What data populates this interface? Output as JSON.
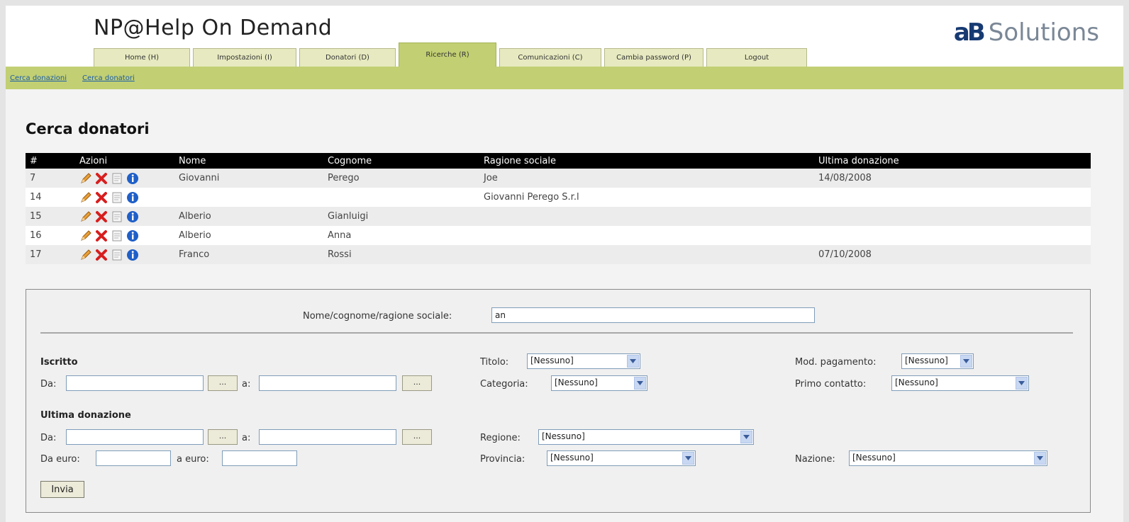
{
  "app": {
    "title": "NP@Help On Demand",
    "brand_mark": "aB",
    "brand_text": "Solutions"
  },
  "tabs": [
    {
      "label": "Home (H)",
      "active": false
    },
    {
      "label": "Impostazioni (I)",
      "active": false
    },
    {
      "label": "Donatori (D)",
      "active": false
    },
    {
      "label": "Ricerche (R)",
      "active": true
    },
    {
      "label": "Comunicazioni (C)",
      "active": false
    },
    {
      "label": "Cambia password (P)",
      "active": false
    },
    {
      "label": "Logout",
      "active": false
    }
  ],
  "subnav": [
    "Cerca donazioni",
    "Cerca donatori"
  ],
  "page": {
    "title": "Cerca donatori"
  },
  "table": {
    "headers": [
      "#",
      "Azioni",
      "Nome",
      "Cognome",
      "Ragione sociale",
      "Ultima donazione"
    ],
    "rows": [
      {
        "id": "7",
        "nome": "Giovanni",
        "cognome": "Perego",
        "ragione": "Joe",
        "ultima": "14/08/2008"
      },
      {
        "id": "14",
        "nome": "",
        "cognome": "",
        "ragione": "Giovanni Perego S.r.l",
        "ultima": ""
      },
      {
        "id": "15",
        "nome": "Alberio",
        "cognome": "Gianluigi",
        "ragione": "",
        "ultima": ""
      },
      {
        "id": "16",
        "nome": "Alberio",
        "cognome": "Anna",
        "ragione": "",
        "ultima": ""
      },
      {
        "id": "17",
        "nome": "Franco",
        "cognome": "Rossi",
        "ragione": "",
        "ultima": "07/10/2008"
      }
    ],
    "action_icons": [
      "edit-pencil-icon",
      "delete-x-icon",
      "document-icon",
      "info-icon"
    ]
  },
  "form": {
    "name_label": "Nome/cognome/ragione sociale:",
    "name_value": "an",
    "iscritto": {
      "heading": "Iscritto",
      "da_label": "Da:",
      "a_label": "a:",
      "pick_label": "..."
    },
    "ultima": {
      "heading": "Ultima donazione",
      "da_label": "Da:",
      "a_label": "a:",
      "pick_label": "..."
    },
    "da_euro_label": "Da euro:",
    "a_euro_label": "a euro:",
    "titolo": {
      "label": "Titolo:",
      "value": "[Nessuno]"
    },
    "categoria": {
      "label": "Categoria:",
      "value": "[Nessuno]"
    },
    "regione": {
      "label": "Regione:",
      "value": "[Nessuno]"
    },
    "provincia": {
      "label": "Provincia:",
      "value": "[Nessuno]"
    },
    "mod_pagamento": {
      "label": "Mod. pagamento:",
      "value": "[Nessuno]"
    },
    "primo_contatto": {
      "label": "Primo contatto:",
      "value": "[Nessuno]"
    },
    "nazione": {
      "label": "Nazione:",
      "value": "[Nessuno]"
    },
    "submit_label": "Invia"
  },
  "colors": {
    "accent": "#c2cf73",
    "tab": "#e7eac0",
    "header_bg": "#000000",
    "link": "#1b5da8",
    "brand": "#173a72"
  }
}
